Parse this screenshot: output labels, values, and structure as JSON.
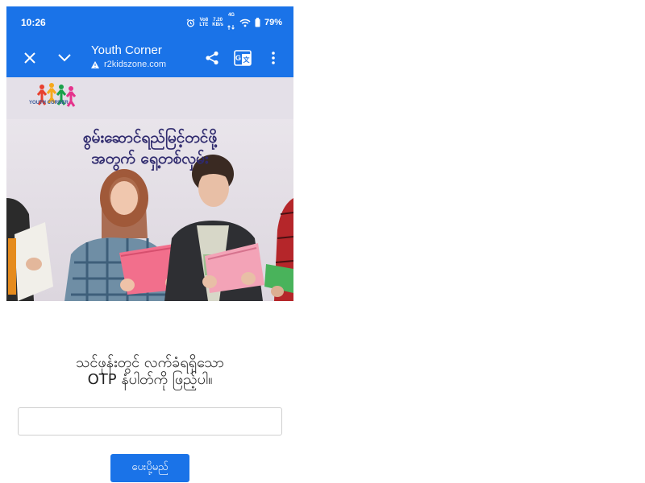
{
  "status_bar": {
    "time": "10:26",
    "net1": "Vo8",
    "net2": "LTE",
    "speed1": "7.20",
    "speed2": "KB/s",
    "gen": "4G",
    "battery": "79%"
  },
  "toolbar": {
    "title": "Youth Corner",
    "url": "r2kidszone.com"
  },
  "hero": {
    "logo_text": "YOUTH CORNER",
    "title_line1": "စွမ်းဆောင်ရည်မြင့်တင်ဖို့",
    "title_line2": "အတွက် ရှေ့တစ်လှမ်း"
  },
  "form": {
    "prompt_line1": "သင်ဖုန်းတွင် လက်ခံရရှိသော",
    "prompt_line2": "OTP နံပါတ်ကို ဖြည့်ပါ။",
    "otp_value": "",
    "otp_placeholder": "",
    "submit_label": "ပေးပို့မည်"
  },
  "colors": {
    "accent": "#1a73e8",
    "title_text": "#2f2a6e"
  },
  "icons": {
    "close": "close-icon",
    "expand": "chevron-down-icon",
    "share": "share-icon",
    "translate": "translate-icon",
    "menu": "more-vert-icon",
    "warning": "warning-icon"
  }
}
